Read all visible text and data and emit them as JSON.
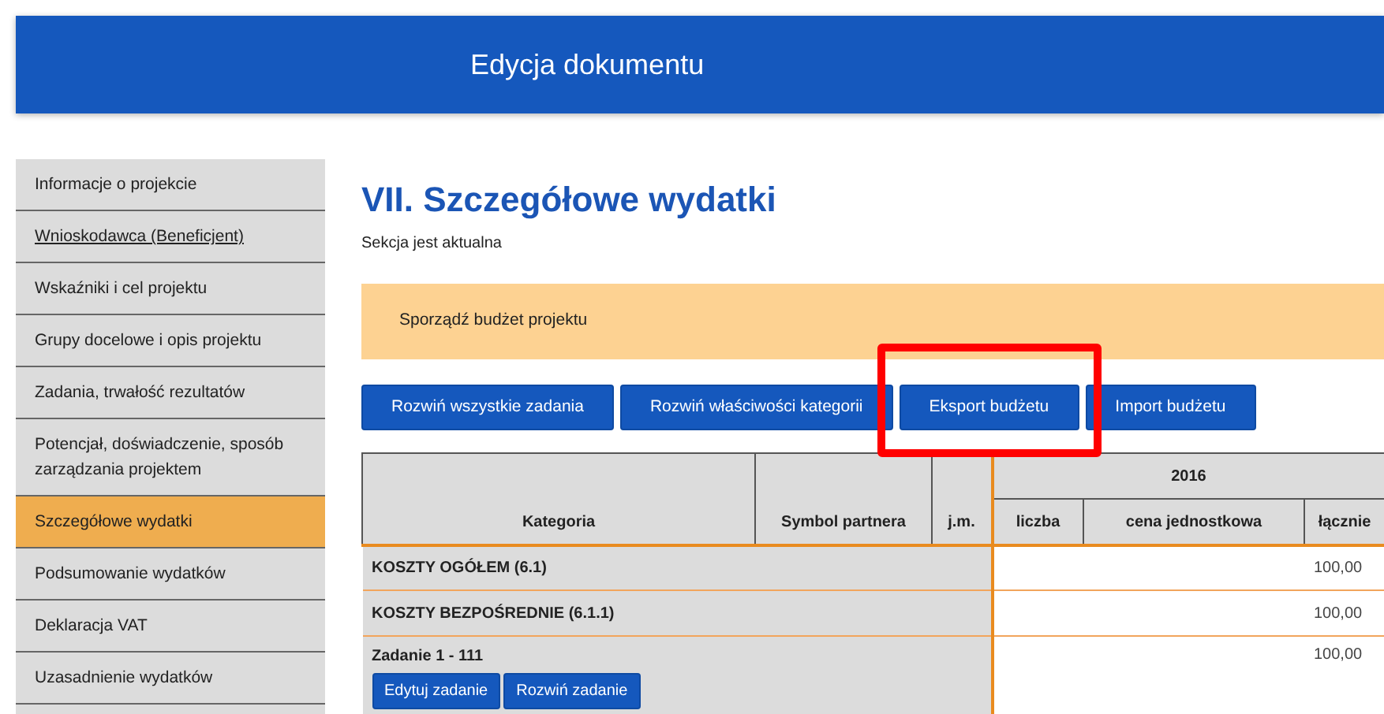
{
  "header": {
    "title": "Edycja dokumentu"
  },
  "sidebar": {
    "items": [
      {
        "label": "Informacje o projekcie",
        "selected": false,
        "hovered": false
      },
      {
        "label": "Wnioskodawca (Beneficjent)",
        "selected": false,
        "hovered": true
      },
      {
        "label": "Wskaźniki i cel projektu",
        "selected": false,
        "hovered": false
      },
      {
        "label": "Grupy docelowe i opis projektu",
        "selected": false,
        "hovered": false
      },
      {
        "label": "Zadania, trwałość rezultatów",
        "selected": false,
        "hovered": false
      },
      {
        "label": "Potencjał, doświadczenie, sposób zarządzania projektem",
        "selected": false,
        "hovered": false
      },
      {
        "label": "Szczegółowe wydatki",
        "selected": true,
        "hovered": false
      },
      {
        "label": "Podsumowanie wydatków",
        "selected": false,
        "hovered": false
      },
      {
        "label": "Deklaracja VAT",
        "selected": false,
        "hovered": false
      },
      {
        "label": "Uzasadnienie wydatków",
        "selected": false,
        "hovered": false
      }
    ]
  },
  "section": {
    "title": "VII. Szczegółowe wydatki",
    "status": "Sekcja jest aktualna",
    "alert": "Sporządź budżet projektu",
    "buttons": [
      {
        "label": "Rozwiń wszystkie zadania",
        "highlighted": false
      },
      {
        "label": "Rozwiń właściwości kategorii",
        "highlighted": false
      },
      {
        "label": "Eksport budżetu",
        "highlighted": true
      },
      {
        "label": "Import budżetu",
        "highlighted": false
      }
    ]
  },
  "table": {
    "columns": [
      "Kategoria",
      "Symbol partnera",
      "j.m."
    ],
    "year": "2016",
    "year_columns": [
      "liczba",
      "cena jednostkowa",
      "łącznie"
    ],
    "rows": [
      {
        "kind": "category",
        "label": "KOSZTY OGÓŁEM (6.1)",
        "total": "100,00"
      },
      {
        "kind": "category",
        "label": "KOSZTY BEZPOŚREDNIE (6.1.1)",
        "total": "100,00"
      },
      {
        "kind": "task",
        "label": "Zadanie 1 - 111",
        "total": "100,00",
        "buttons": [
          "Edytuj zadanie",
          "Rozwiń zadanie"
        ]
      }
    ]
  }
}
